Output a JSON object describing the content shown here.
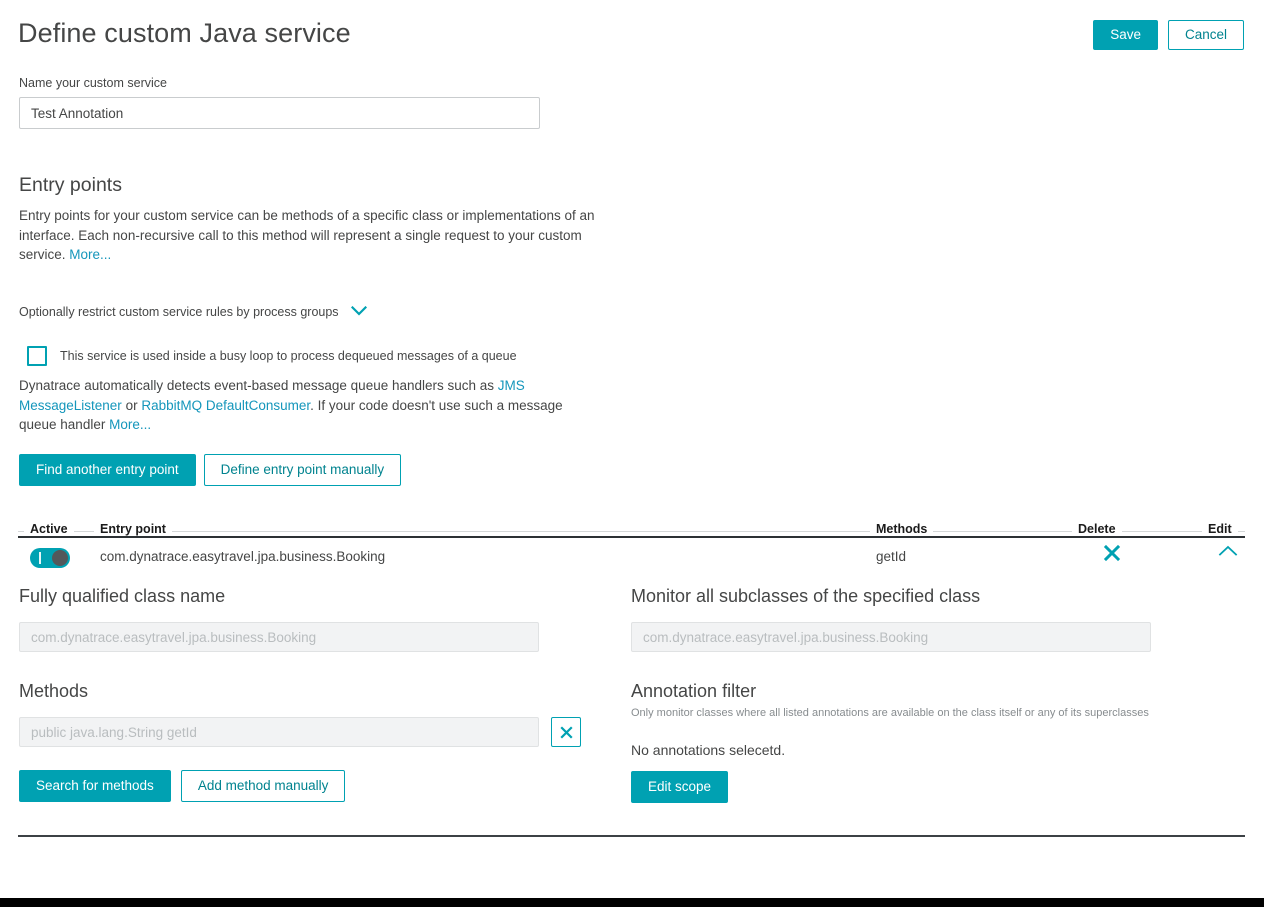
{
  "colors": {
    "accent": "#00a1b2",
    "link": "#1496bb",
    "text": "#454646",
    "muted": "#878c8f",
    "disabled_text": "#b9bdbf",
    "rule_dark": "#2c3134"
  },
  "header": {
    "title": "Define custom Java service",
    "save_label": "Save",
    "cancel_label": "Cancel"
  },
  "name_field": {
    "label": "Name your custom service",
    "value": "Test Annotation",
    "placeholder": "Name your custom service"
  },
  "entry_points": {
    "title": "Entry points",
    "description_before_link": "Entry points for your custom service can be methods of a specific class or implementations of an interface. Each non-recursive call to this method will represent a single request to your custom service. ",
    "more_link": "More...",
    "restrict_label": "Optionally restrict custom service rules by process groups",
    "restrict_chevron": "chevron-down-icon",
    "checkbox_label": "This service is used inside a busy loop to process dequeued messages of a queue",
    "checkbox_checked": "false",
    "queue_desc_1": "Dynatrace automatically detects event-based message queue handlers such as ",
    "queue_link_1": "JMS MessageListener",
    "queue_desc_2": " or ",
    "queue_link_2": "RabbitMQ DefaultConsumer",
    "queue_desc_3": ". If your code doesn't use such a message queue handler ",
    "queue_more_link": "More...",
    "find_button": "Find another entry point",
    "define_button": "Define entry point manually"
  },
  "table": {
    "headers": {
      "active": "Active",
      "entry_point": "Entry point",
      "methods": "Methods",
      "delete": "Delete",
      "edit": "Edit"
    },
    "rows": [
      {
        "active": "true",
        "entry_point": "com.dynatrace.easytravel.jpa.business.Booking",
        "methods": "getId",
        "delete_icon": "close-x-icon",
        "edit_icon": "chevron-up-icon"
      }
    ]
  },
  "detail": {
    "class_name": {
      "label": "Fully qualified class name",
      "value": "com.dynatrace.easytravel.jpa.business.Booking"
    },
    "subclasses": {
      "label": "Monitor all subclasses of the specified class",
      "value": "com.dynatrace.easytravel.jpa.business.Booking"
    },
    "methods": {
      "label": "Methods",
      "value": "public java.lang.String getId",
      "remove_icon": "close-x-icon",
      "search_button": "Search for methods",
      "add_button": "Add method manually"
    },
    "annotation_filter": {
      "label": "Annotation filter",
      "sublabel": "Only monitor classes where all listed annotations are available on the class itself or any of its superclasses",
      "empty_text": "No annotations selecetd.",
      "edit_scope_button": "Edit scope"
    }
  }
}
